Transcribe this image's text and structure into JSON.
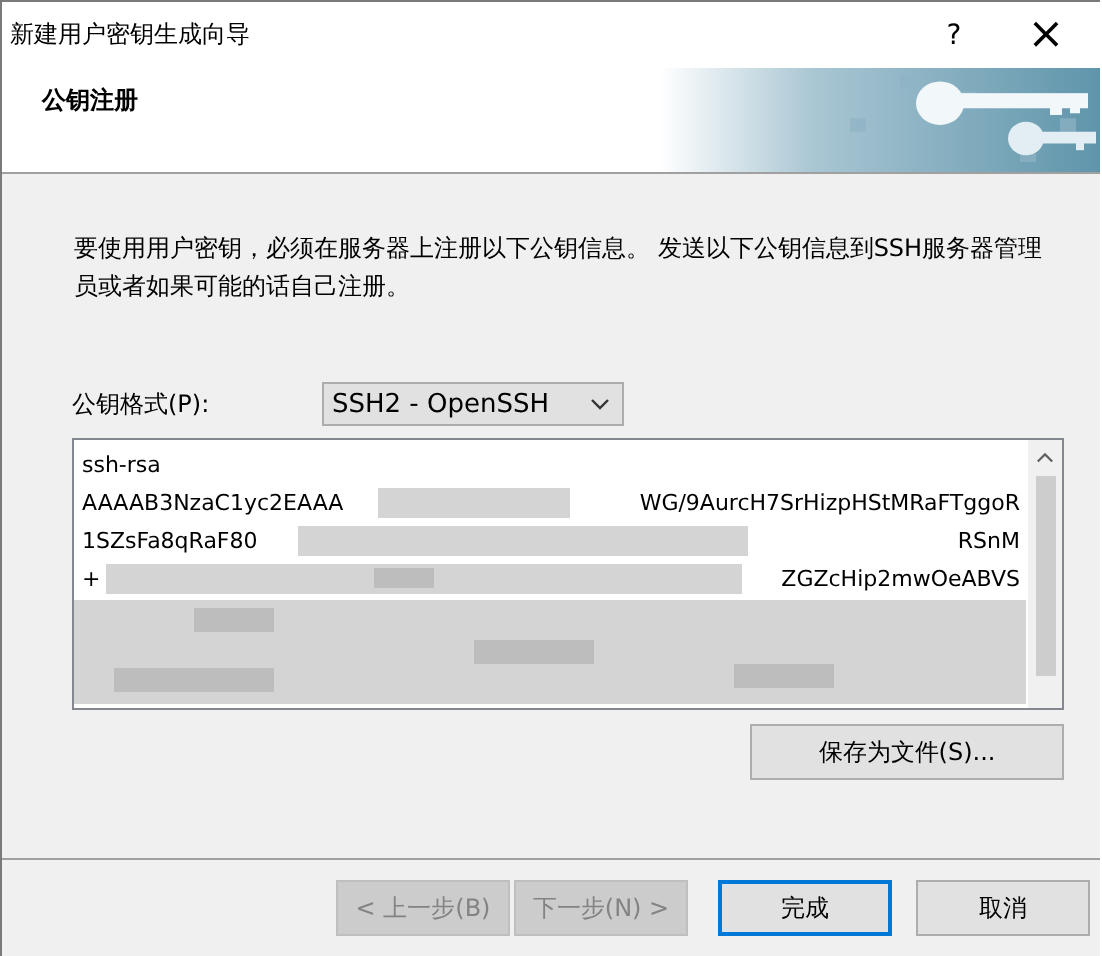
{
  "window": {
    "title": "新建用户密钥生成向导",
    "help": "?",
    "close": "×"
  },
  "header": {
    "title": "公钥注册"
  },
  "instructions": "要使用用户密钥，必须在服务器上注册以下公钥信息。 发送以下公钥信息到SSH服务器管理员或者如果可能的话自己注册。",
  "format": {
    "label": "公钥格式(P):",
    "value": "SSH2 - OpenSSH"
  },
  "key_text": {
    "lines": [
      {
        "left": "ssh-rsa"
      },
      {
        "left": "AAAAB3NzaC1yc2EAAA",
        "right": "WG/9AurcH7SrHizpHStMRaFTggoR"
      },
      {
        "left": "1SZsFa8qRaF80",
        "right": "RSnM"
      },
      {
        "left": "+",
        "right": "ZGZcHip2mwOeABVS"
      }
    ]
  },
  "save_button": "保存为文件(S)...",
  "buttons": [
    {
      "label": "< 上一步(B)",
      "disabled": true,
      "default": false
    },
    {
      "label": "下一步(N) >",
      "disabled": true,
      "default": false
    },
    {
      "label": "完成",
      "disabled": false,
      "default": true
    },
    {
      "label": "取消",
      "disabled": false,
      "default": false
    }
  ]
}
